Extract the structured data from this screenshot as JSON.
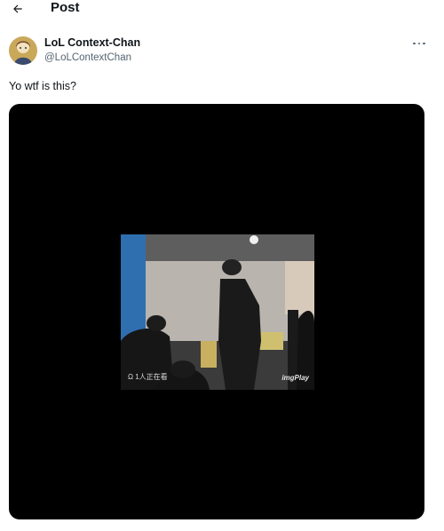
{
  "header": {
    "title": "Post",
    "back_icon": "arrow-left-icon"
  },
  "post": {
    "author": {
      "display_name": "LoL Context-Chan",
      "handle": "@LoLContextChan",
      "avatar_icon": "avatar-image"
    },
    "more_icon": "more-horizontal-icon",
    "text": "Yo wtf is this?",
    "media": {
      "type": "video",
      "caption": "Ω 1人正在看",
      "watermark": "imgPlay"
    }
  },
  "colors": {
    "text_primary": "#0f1419",
    "text_secondary": "#536471",
    "media_bg": "#000000"
  }
}
